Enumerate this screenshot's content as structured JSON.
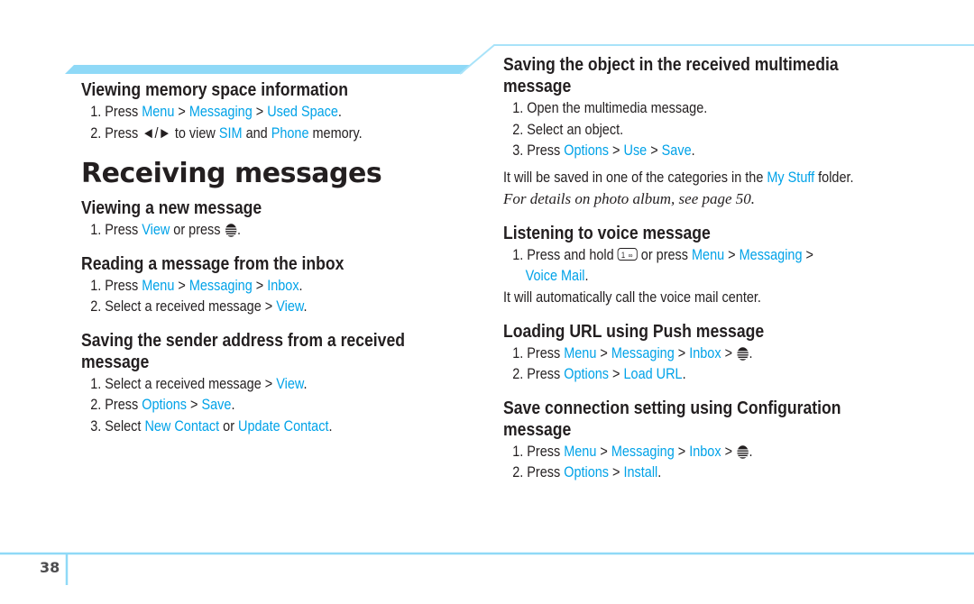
{
  "page": {
    "number": "38",
    "accent_color": "#00a2e8",
    "rule_color": "#8fd9f7"
  },
  "left": {
    "memory": {
      "title": "Viewing memory space information",
      "steps": [
        [
          "1. Press ",
          "Menu",
          " > ",
          "Messaging",
          " > ",
          "Used Space",
          "."
        ],
        [
          "2. Press ",
          "◄/►",
          " to view ",
          "SIM",
          " and ",
          "Phone",
          " memory."
        ]
      ]
    },
    "section_title": "Receiving messages",
    "new_message": {
      "title": "Viewing a new message",
      "step1": {
        "prefix": "1. Press ",
        "kw1": "View",
        "mid": " or press ",
        "icon": "att-globe-key-icon",
        "suffix": "."
      }
    },
    "inbox": {
      "title": "Reading a message from the inbox",
      "step1": [
        "1. Press ",
        "Menu",
        " > ",
        "Messaging",
        " > ",
        "Inbox",
        "."
      ],
      "step2": [
        "2. Select a received message > ",
        "View",
        "."
      ]
    },
    "sender": {
      "title": "Saving the sender address from a received message",
      "step1": [
        "1. Select a received message > ",
        "View",
        "."
      ],
      "step2": [
        "2. Press ",
        "Options",
        " > ",
        "Save",
        "."
      ],
      "step3": [
        "3. Select ",
        "New Contact",
        " or ",
        "Update Contact",
        "."
      ]
    }
  },
  "right": {
    "multimedia": {
      "title": "Saving the object in the received multimedia message",
      "step1": "1. Open the multimedia message.",
      "step2": "2. Select an object.",
      "step3": [
        "3. Press ",
        "Options",
        " > ",
        "Use",
        " > ",
        "Save",
        "."
      ],
      "note": [
        "It will be saved in one of the categories in the ",
        "My Stuff",
        " folder."
      ],
      "italic_note": "For details on photo album, see page 50."
    },
    "voice": {
      "title": "Listening to voice message",
      "step1": {
        "prefix": "1. Press and hold ",
        "key_label": "1",
        "key_sub": "∞",
        "mid": " or press ",
        "kw1": "Menu",
        "sep1": " > ",
        "kw2": "Messaging",
        "sep2": " >",
        "kw3": "Voice Mail",
        "suffix": "."
      },
      "note": "It will automatically call the voice mail center."
    },
    "push": {
      "title": "Loading URL using Push message",
      "step1": [
        "1. Press ",
        "Menu",
        " > ",
        "Messaging",
        " > ",
        "Inbox",
        " > "
      ],
      "step2": [
        "2. Press ",
        "Options",
        " > ",
        "Load URL",
        "."
      ]
    },
    "config": {
      "title": "Save connection setting using Configuration message",
      "step1": [
        "1. Press ",
        "Menu",
        " > ",
        "Messaging",
        " > ",
        "Inbox",
        " > "
      ],
      "step2": [
        "2. Press ",
        "Options",
        " > ",
        "Install",
        "."
      ]
    }
  }
}
